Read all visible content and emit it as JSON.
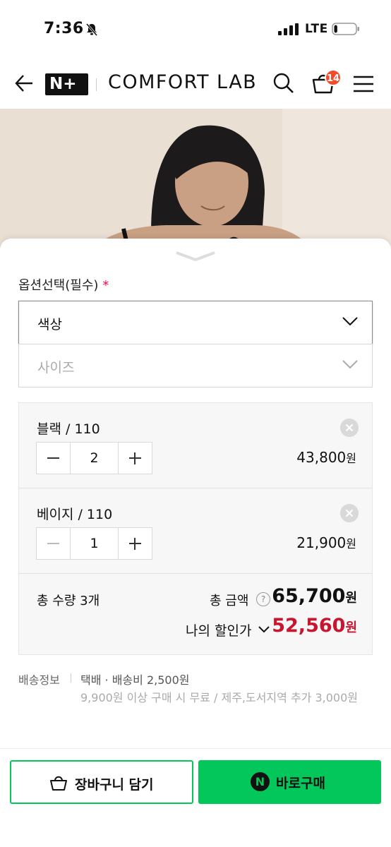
{
  "status_bar": {
    "time": "7:36",
    "network": "LTE",
    "battery_level": 0.15
  },
  "nav": {
    "logo": "N+",
    "brand": "COMFORT LAB",
    "cart_count": "14"
  },
  "option": {
    "title": "옵션선택(필수)",
    "required_mark": "*",
    "color_label": "색상",
    "size_label": "사이즈"
  },
  "items": [
    {
      "name": "블랙 / 110",
      "qty": "2",
      "price": "43,800",
      "won": "원"
    },
    {
      "name": "베이지 / 110",
      "qty": "1",
      "price": "21,900",
      "won": "원"
    }
  ],
  "summary": {
    "count": "총 수량 3개",
    "total_label": "총 금액",
    "qmark": "?",
    "total": "65,700",
    "won": "원",
    "discount_label": "나의 할인가",
    "discount": "52,560"
  },
  "shipping": {
    "label": "배송정보",
    "main": "택배 · 배송비 2,500원",
    "note": "9,900원 이상 구매 시 무료 / 제주,도서지역 추가 3,000원"
  },
  "actions": {
    "cart": "장바구니 담기",
    "buy": "바로구매",
    "naver_logo": "N"
  },
  "colors": {
    "accent": "#03c75a",
    "discount": "#c9152f",
    "badge": "#f34a2d"
  }
}
